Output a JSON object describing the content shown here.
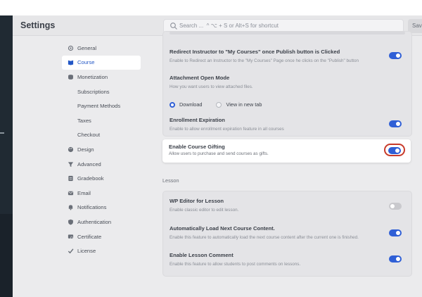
{
  "header": {
    "title": "Settings",
    "search_placeholder": "Search ...  ^ ⌥ + S or Alt+S for shortcut",
    "save_label": "Save"
  },
  "sidebar": {
    "items": [
      {
        "label": "General",
        "icon": "gear-icon",
        "active": false
      },
      {
        "label": "Course",
        "icon": "book-icon",
        "active": true
      },
      {
        "label": "Monetization",
        "icon": "coins-icon",
        "active": false
      },
      {
        "label": "Subscriptions",
        "sub": true
      },
      {
        "label": "Payment Methods",
        "sub": true
      },
      {
        "label": "Taxes",
        "sub": true
      },
      {
        "label": "Checkout",
        "sub": true
      },
      {
        "label": "Design",
        "icon": "palette-icon"
      },
      {
        "label": "Advanced",
        "icon": "filter-icon"
      },
      {
        "label": "Gradebook",
        "icon": "gradebook-icon"
      },
      {
        "label": "Email",
        "icon": "mail-icon"
      },
      {
        "label": "Notifications",
        "icon": "bell-icon"
      },
      {
        "label": "Authentication",
        "icon": "shield-icon"
      },
      {
        "label": "Certificate",
        "icon": "certificate-icon"
      },
      {
        "label": "License",
        "icon": "check-badge-icon"
      }
    ]
  },
  "course_settings": {
    "redirect": {
      "title": "Redirect Instructor to \"My Courses\" once Publish button is Clicked",
      "desc": "Enable to Redirect an Instructor to the \"My Courses\" Page once he clicks on the \"Publish\" button",
      "enabled": true
    },
    "attachment": {
      "title": "Attachment Open Mode",
      "desc": "How you want users to view attached files.",
      "options": [
        "Download",
        "View in new tab"
      ],
      "selected": "Download"
    },
    "enrollment_expiration": {
      "title": "Enrollment Expiration",
      "desc": "Enable to allow enrollment expiration feature in all courses",
      "enabled": true
    },
    "gifting": {
      "title": "Enable Course Gifting",
      "desc": "Allow users to purchase and send courses as gifts.",
      "enabled": true
    }
  },
  "lesson": {
    "section_label": "Lesson",
    "wp_editor": {
      "title": "WP Editor for Lesson",
      "desc": "Enable classic editor to edit lesson.",
      "enabled": false
    },
    "auto_load": {
      "title": "Automatically Load Next Course Content.",
      "desc": "Enable this feature to automatically load the next course content after the current one is finished.",
      "enabled": true
    },
    "lesson_comment": {
      "title": "Enable Lesson Comment",
      "desc": "Enable this feature to allow students to post comments on lessons.",
      "enabled": true
    }
  },
  "colors": {
    "accent": "#2f5fd6",
    "highlight_ring": "#c83a2a",
    "sidebar_dark": "#202a33"
  }
}
